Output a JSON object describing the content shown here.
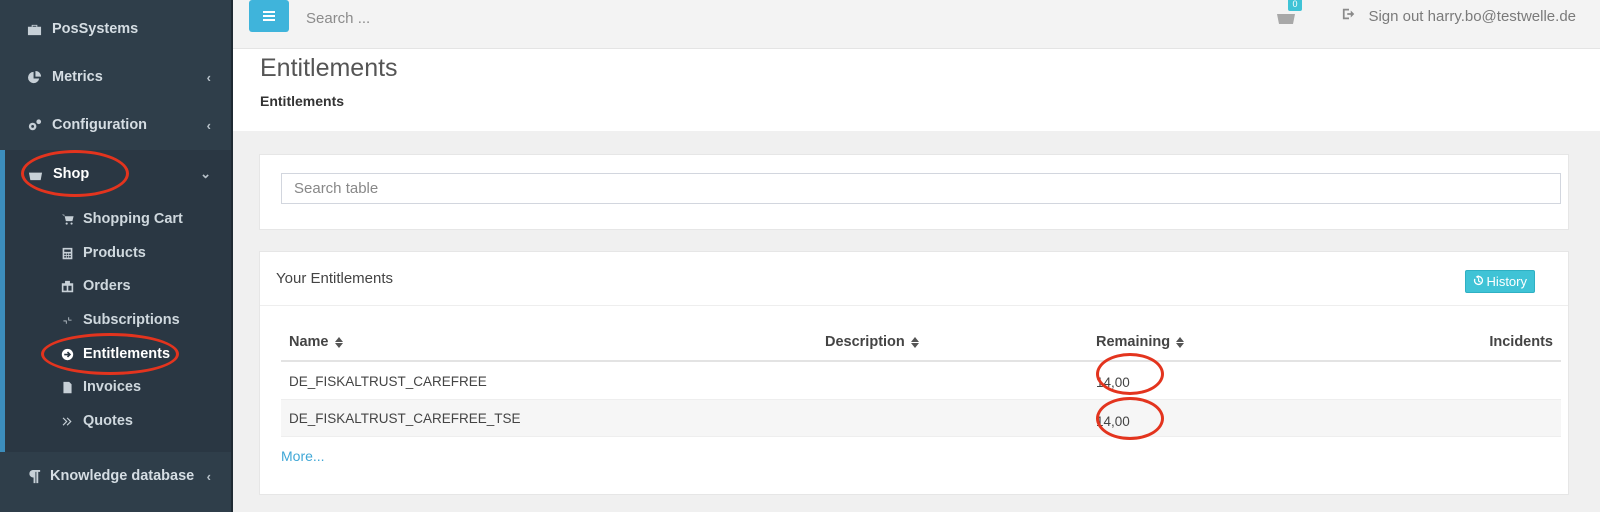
{
  "sidebar": {
    "items": [
      {
        "label": "PosSystems",
        "icon": "briefcase-icon"
      },
      {
        "label": "Metrics",
        "icon": "pie-chart-icon",
        "chevron": "‹"
      },
      {
        "label": "Configuration",
        "icon": "gears-icon",
        "chevron": "‹"
      },
      {
        "label": "Shop",
        "icon": "basket-icon",
        "chevron": "⌄"
      },
      {
        "label": "Knowledge database",
        "icon": "paragraph-icon",
        "chevron": "‹"
      }
    ],
    "shop_sub": [
      {
        "label": "Shopping Cart",
        "icon": "cart-icon"
      },
      {
        "label": "Products",
        "icon": "calculator-icon"
      },
      {
        "label": "Orders",
        "icon": "orders-icon"
      },
      {
        "label": "Subscriptions",
        "icon": "compress-icon"
      },
      {
        "label": "Entitlements",
        "icon": "arrow-circle-icon"
      },
      {
        "label": "Invoices",
        "icon": "file-icon"
      },
      {
        "label": "Quotes",
        "icon": "double-chevron-icon"
      }
    ]
  },
  "topbar": {
    "search_placeholder": "Search ...",
    "cart_count": "0",
    "signout_label": "Sign out harry.bo@testwelle.de"
  },
  "page": {
    "title": "Entitlements",
    "breadcrumb": "Entitlements"
  },
  "table_search": {
    "placeholder": "Search table"
  },
  "entitlements": {
    "title": "Your Entitlements",
    "history_label": "History",
    "columns": [
      "Name",
      "Description",
      "Remaining",
      "Incidents"
    ],
    "rows": [
      {
        "name": "DE_FISKALTRUST_CAREFREE",
        "description": "",
        "remaining": "14,00",
        "incidents": ""
      },
      {
        "name": "DE_FISKALTRUST_CAREFREE_TSE",
        "description": "",
        "remaining": "14,00",
        "incidents": ""
      }
    ],
    "more_label": "More..."
  },
  "colors": {
    "sidebar_bg": "#2f3e4a",
    "accent": "#3fb4db",
    "history_button": "#3fc3d6",
    "annotation": "#e3341e"
  }
}
